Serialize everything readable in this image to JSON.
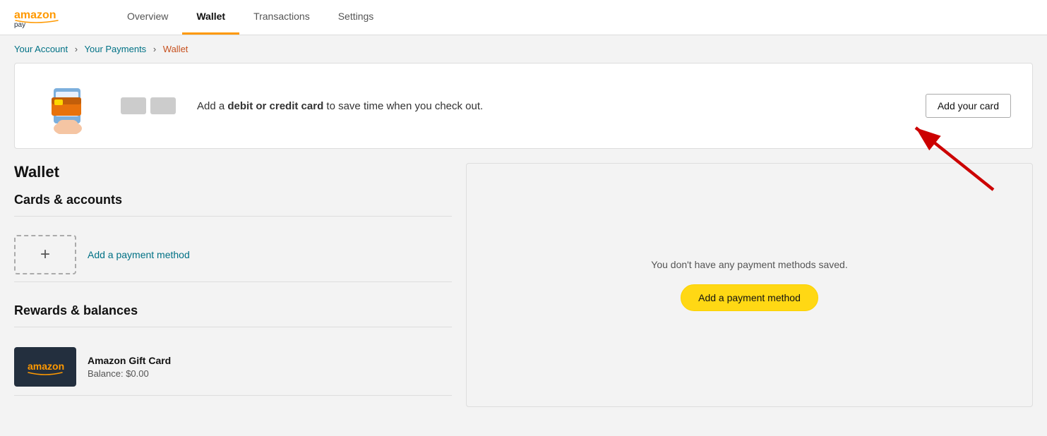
{
  "header": {
    "logo_alt": "Amazon Pay",
    "nav_items": [
      {
        "label": "Overview",
        "active": false,
        "id": "overview"
      },
      {
        "label": "Wallet",
        "active": true,
        "id": "wallet"
      },
      {
        "label": "Transactions",
        "active": false,
        "id": "transactions"
      },
      {
        "label": "Settings",
        "active": false,
        "id": "settings"
      }
    ]
  },
  "breadcrumb": {
    "items": [
      {
        "label": "Your Account",
        "link": true
      },
      {
        "label": "Your Payments",
        "link": true
      },
      {
        "label": "Wallet",
        "link": false,
        "current": true
      }
    ],
    "separator": "›"
  },
  "promo_banner": {
    "promo_text_prefix": "Add a ",
    "promo_text_bold": "debit or credit card",
    "promo_text_suffix": " to save time when you check out.",
    "button_label": "Add your card"
  },
  "wallet_section": {
    "title": "Wallet",
    "cards_accounts": {
      "title": "Cards & accounts",
      "add_link_label": "Add a payment method"
    },
    "rewards_balances": {
      "title": "Rewards & balances",
      "gift_card": {
        "title": "Amazon Gift Card",
        "balance_label": "Balance: $0.00"
      }
    }
  },
  "right_panel": {
    "no_methods_text": "You don't have any payment methods saved.",
    "add_button_label": "Add a payment method"
  },
  "icons": {
    "plus": "+",
    "amazon_arrow": "→"
  }
}
